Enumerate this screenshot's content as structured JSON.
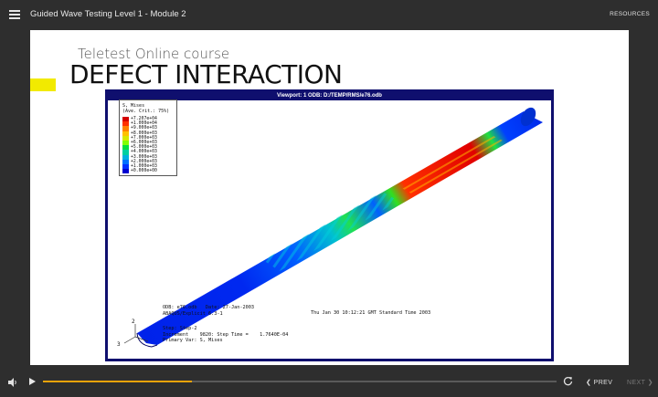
{
  "header": {
    "course_title": "Guided Wave Testing Level 1 - Module 2",
    "resources_label": "RESOURCES"
  },
  "slide": {
    "subtitle": "Teletest Online course",
    "title": "DEFECT INTERACTION"
  },
  "viewport": {
    "header": "Viewport: 1     ODB: D:/TEMP/RMS/e76.odb",
    "legend": {
      "title_lines": [
        "S, Mises",
        "(Ave. Crit.: 75%)"
      ],
      "entries": [
        {
          "value": "+7.207e+04",
          "color": "#d40000"
        },
        {
          "value": "+1.000e+04",
          "color": "#ff3000"
        },
        {
          "value": "+9.000e+03",
          "color": "#ff8000"
        },
        {
          "value": "+8.000e+03",
          "color": "#ffc000"
        },
        {
          "value": "+7.000e+03",
          "color": "#d8e800"
        },
        {
          "value": "+6.000e+03",
          "color": "#80ff00"
        },
        {
          "value": "+5.000e+03",
          "color": "#00e040"
        },
        {
          "value": "+4.000e+03",
          "color": "#00d0a0"
        },
        {
          "value": "+3.000e+03",
          "color": "#00b0e0"
        },
        {
          "value": "+2.000e+03",
          "color": "#0070ff"
        },
        {
          "value": "+1.000e+03",
          "color": "#0030ff"
        },
        {
          "value": "+0.000e+00",
          "color": "#0000d0"
        }
      ]
    },
    "info_left": "ODB: e76.odb   Date: 27-Jan-2003\nABAQUS/Explicit 6.3-1",
    "info_right": "Thu Jan 30 10:12:21 GMT Standard Time 2003",
    "info_step": "Step: Step-2\nIncrement    9820: Step Time =    1.7640E-04\nPrimary Var: S, Mises",
    "axis_labels": {
      "y": "2",
      "z": "3",
      "x": "1"
    }
  },
  "player": {
    "progress": 0.29,
    "prev_label": "PREV",
    "next_label": "NEXT",
    "accent_color": "#f0a30a"
  }
}
